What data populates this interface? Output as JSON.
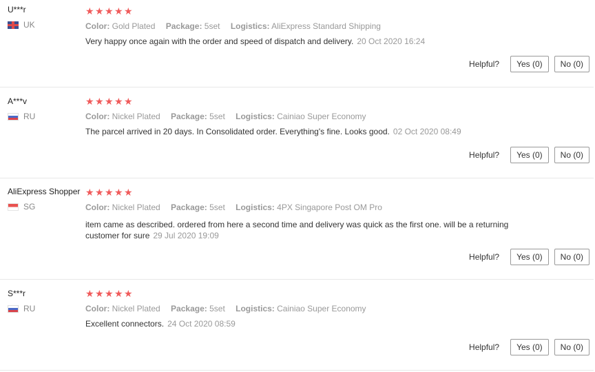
{
  "reviews": [
    {
      "user": "U***r",
      "country": "UK",
      "flag": "flag-uk-icon",
      "rating": 5,
      "color_label": "Color:",
      "color": "Gold Plated",
      "package_label": "Package:",
      "package": "5set",
      "logistics_label": "Logistics:",
      "logistics": "AliExpress Standard Shipping",
      "text": "Very happy once again with the order and speed of dispatch and delivery.",
      "date": "20 Oct 2020 16:24",
      "helpful_label": "Helpful?",
      "yes_label": "Yes (0)",
      "no_label": "No (0)"
    },
    {
      "user": "A***v",
      "country": "RU",
      "flag": "flag-ru-icon",
      "rating": 5,
      "color_label": "Color:",
      "color": "Nickel Plated",
      "package_label": "Package:",
      "package": "5set",
      "logistics_label": "Logistics:",
      "logistics": "Cainiao Super Economy",
      "text": "The parcel arrived in 20 days. In Consolidated order. Everything's fine. Looks good.",
      "date": "02 Oct 2020 08:49",
      "helpful_label": "Helpful?",
      "yes_label": "Yes (0)",
      "no_label": "No (0)"
    },
    {
      "user": "AliExpress Shopper",
      "country": "SG",
      "flag": "flag-sg-icon",
      "rating": 5,
      "color_label": "Color:",
      "color": "Nickel Plated",
      "package_label": "Package:",
      "package": "5set",
      "logistics_label": "Logistics:",
      "logistics": "4PX Singapore Post OM Pro",
      "text": "item came as described. ordered from here a second time and delivery was quick as the first one. will be a returning customer for sure",
      "date": "29 Jul 2020 19:09",
      "helpful_label": "Helpful?",
      "yes_label": "Yes (0)",
      "no_label": "No (0)"
    },
    {
      "user": "S***r",
      "country": "RU",
      "flag": "flag-ru-icon",
      "rating": 5,
      "color_label": "Color:",
      "color": "Nickel Plated",
      "package_label": "Package:",
      "package": "5set",
      "logistics_label": "Logistics:",
      "logistics": "Cainiao Super Economy",
      "text": "Excellent connectors.",
      "date": "24 Oct 2020 08:59",
      "helpful_label": "Helpful?",
      "yes_label": "Yes (0)",
      "no_label": "No (0)"
    }
  ],
  "colors": {
    "star": "#f05b5b",
    "divider": "#e8e8e8",
    "muted": "#999999"
  }
}
